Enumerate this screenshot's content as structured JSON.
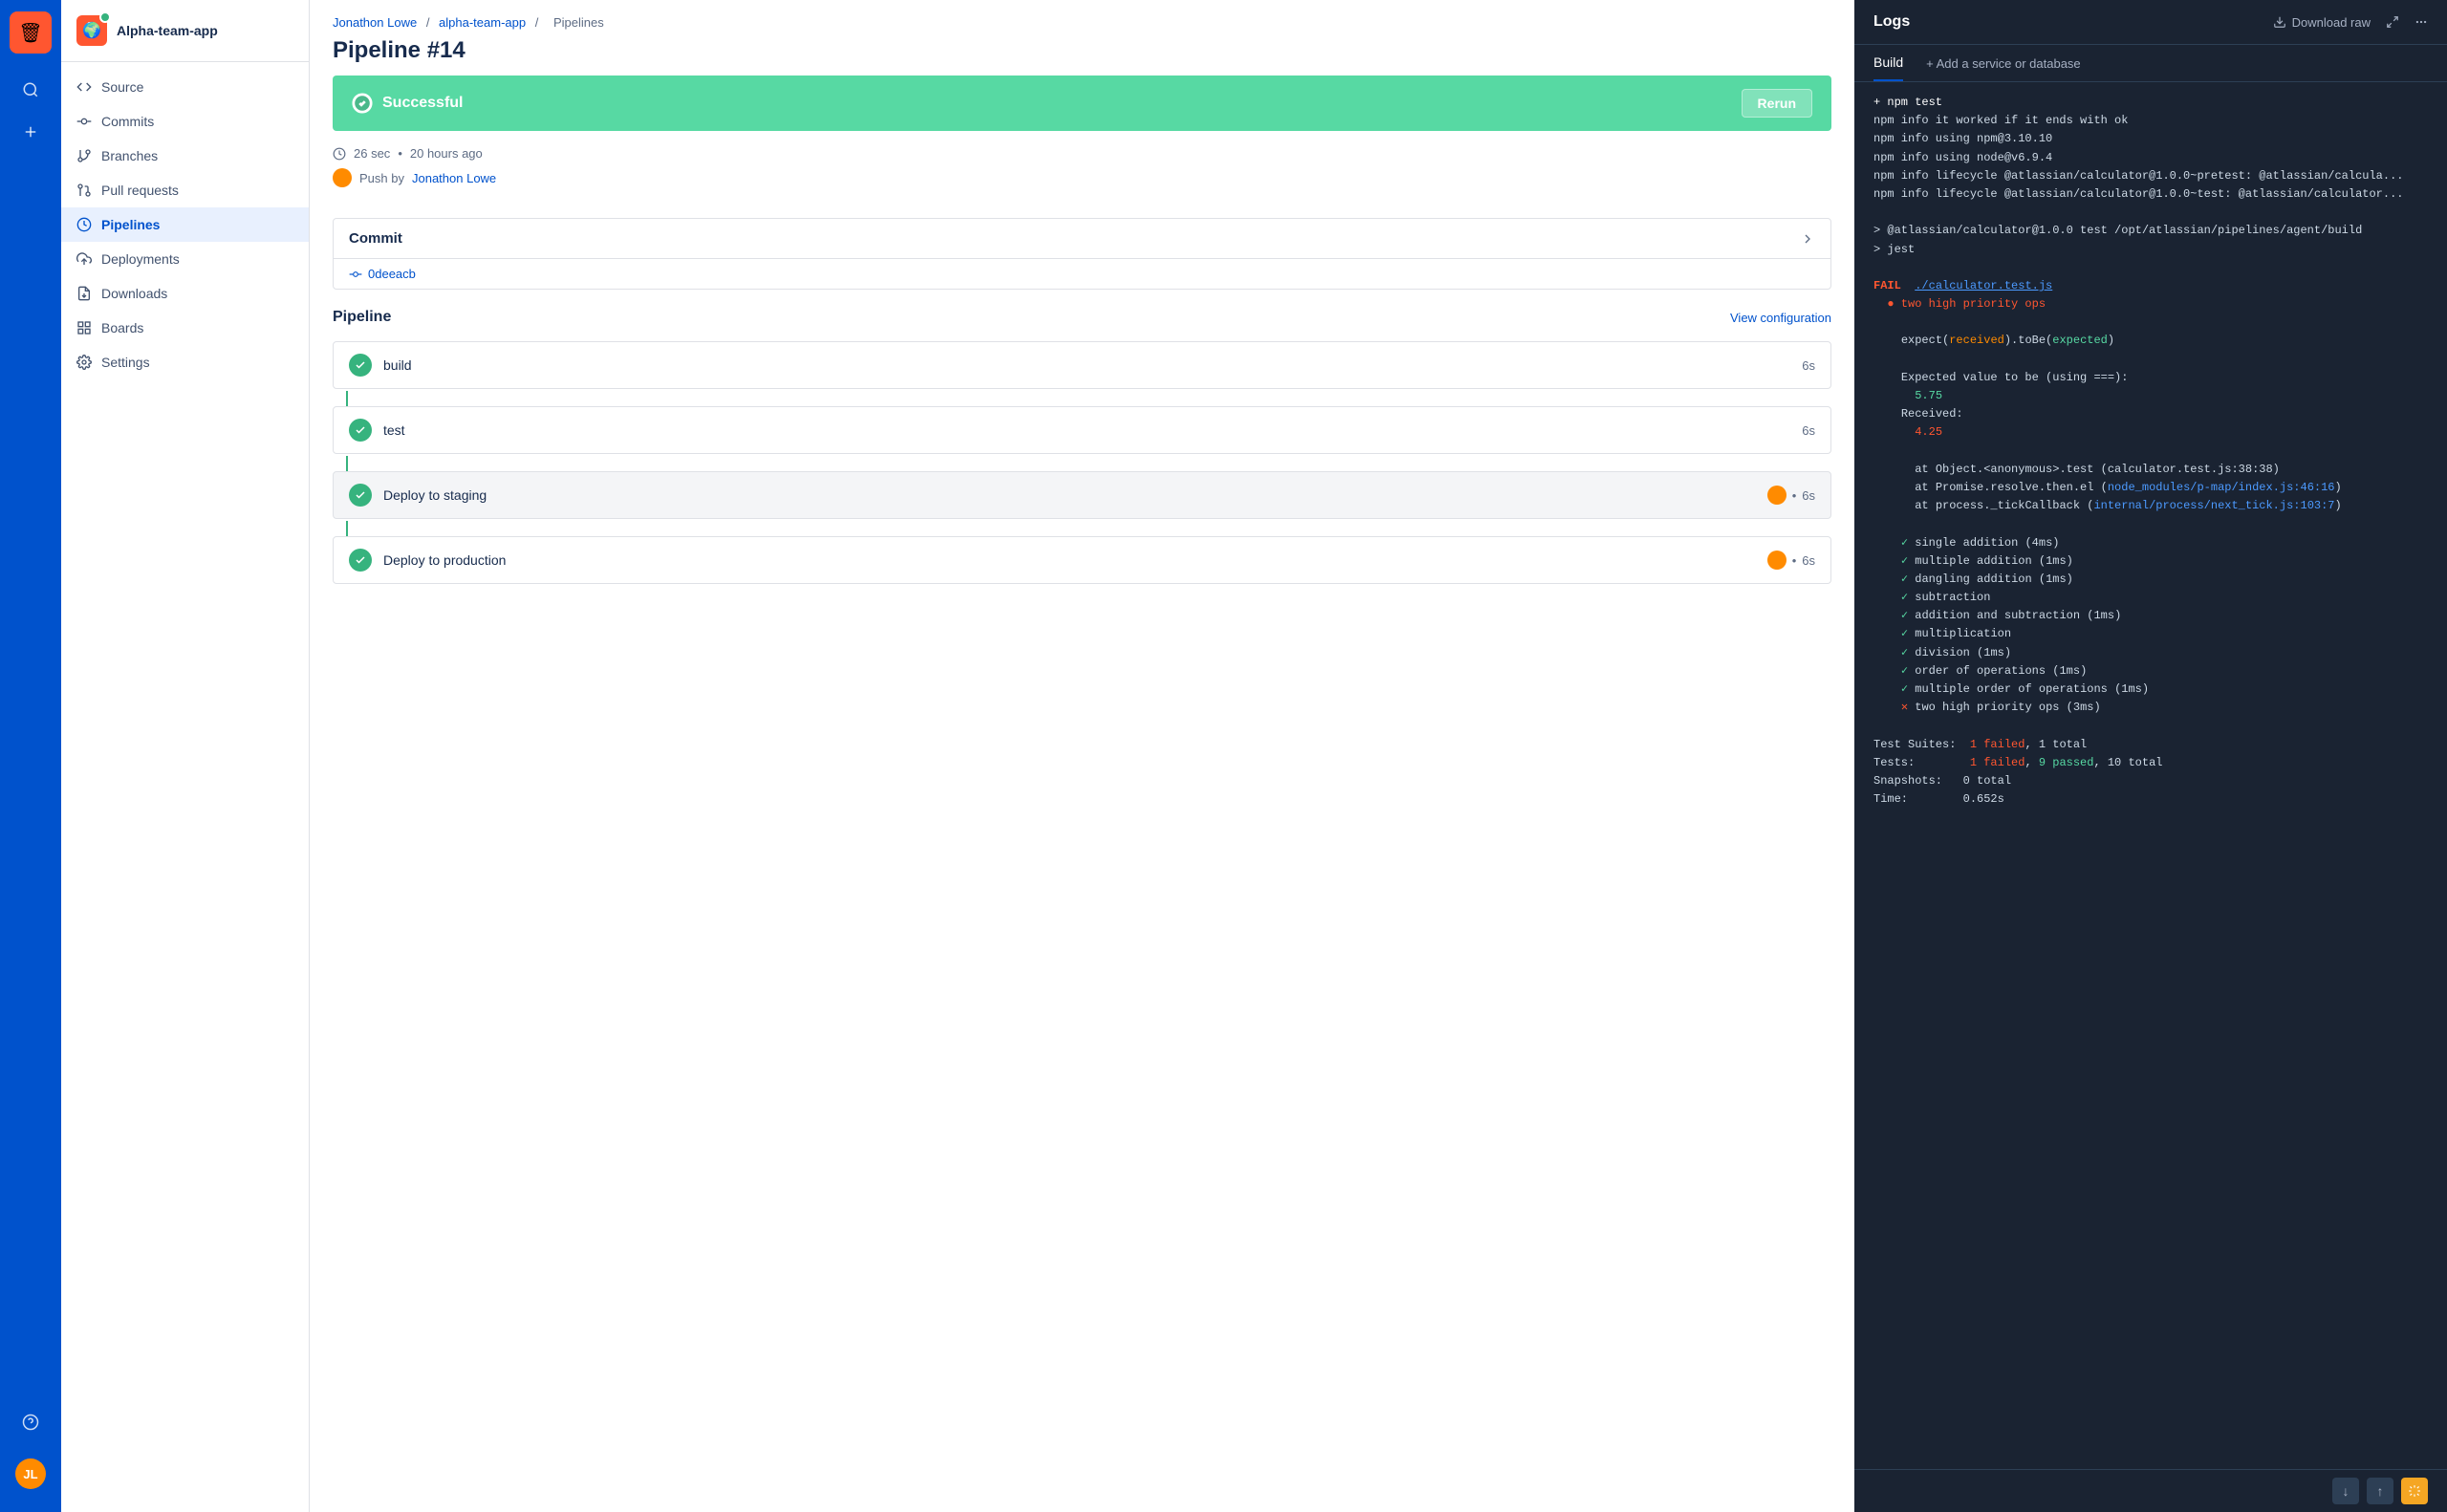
{
  "iconBar": {
    "appEmoji": "🗑",
    "searchLabel": "search",
    "addLabel": "add",
    "helpLabel": "help",
    "userLabel": "user"
  },
  "sidebar": {
    "appName": "Alpha-team-app",
    "appEmoji": "🌍",
    "navItems": [
      {
        "id": "source",
        "label": "Source",
        "icon": "code"
      },
      {
        "id": "commits",
        "label": "Commits",
        "icon": "commits"
      },
      {
        "id": "branches",
        "label": "Branches",
        "icon": "branches"
      },
      {
        "id": "pull-requests",
        "label": "Pull requests",
        "icon": "pr"
      },
      {
        "id": "pipelines",
        "label": "Pipelines",
        "icon": "pipelines",
        "active": true
      },
      {
        "id": "deployments",
        "label": "Deployments",
        "icon": "deployments"
      },
      {
        "id": "downloads",
        "label": "Downloads",
        "icon": "downloads"
      },
      {
        "id": "boards",
        "label": "Boards",
        "icon": "boards"
      },
      {
        "id": "settings",
        "label": "Settings",
        "icon": "settings"
      }
    ]
  },
  "breadcrumb": {
    "items": [
      "Jonathon Lowe",
      "alpha-team-app",
      "Pipelines"
    ]
  },
  "pipeline": {
    "title": "Pipeline #14",
    "status": "Successful",
    "statusColor": "#57d9a3",
    "rerunLabel": "Rerun",
    "duration": "26 sec",
    "timeAgo": "20 hours ago",
    "pushText": "Push by",
    "author": "Jonathon Lowe",
    "commitSection": {
      "label": "Commit",
      "hash": "0deeacb"
    },
    "pipelineSection": {
      "title": "Pipeline",
      "viewConfigLabel": "View configuration",
      "steps": [
        {
          "name": "build",
          "duration": "6s",
          "active": false
        },
        {
          "name": "test",
          "duration": "6s",
          "active": false
        },
        {
          "name": "Deploy to staging",
          "duration": "6s",
          "hasAvatar": true,
          "active": true
        },
        {
          "name": "Deploy to production",
          "duration": "6s",
          "hasAvatar": true,
          "active": false
        }
      ]
    }
  },
  "logs": {
    "title": "Logs",
    "downloadRawLabel": "Download raw",
    "expandLabel": "expand",
    "moreLabel": "more",
    "tabs": [
      {
        "id": "build",
        "label": "Build",
        "active": true
      }
    ],
    "addServiceLabel": "+ Add a service or database",
    "content": [
      {
        "type": "white",
        "text": "+ npm test"
      },
      {
        "type": "normal",
        "text": "npm info it worked if it ends with ok"
      },
      {
        "type": "normal",
        "text": "npm info using npm@3.10.10"
      },
      {
        "type": "normal",
        "text": "npm info using node@v6.9.4"
      },
      {
        "type": "normal",
        "text": "npm info lifecycle @atlassian/calculator@1.0.0~pretest: @atlassian/calcula..."
      },
      {
        "type": "normal",
        "text": "npm info lifecycle @atlassian/calculator@1.0.0~test: @atlassian/calculator..."
      },
      {
        "type": "blank",
        "text": ""
      },
      {
        "type": "normal",
        "text": "> @atlassian/calculator@1.0.0 test /opt/atlassian/pipelines/agent/build"
      },
      {
        "type": "normal",
        "text": "> jest"
      },
      {
        "type": "blank",
        "text": ""
      },
      {
        "type": "fail",
        "text": "FAIL  ./calculator.test.js"
      },
      {
        "type": "red-bullet",
        "text": "  ● two high priority ops"
      },
      {
        "type": "blank",
        "text": ""
      },
      {
        "type": "expect",
        "text": "    expect(received).toBe(expected)"
      },
      {
        "type": "blank",
        "text": ""
      },
      {
        "type": "normal",
        "text": "    Expected value to be (using ===):"
      },
      {
        "type": "green-val",
        "text": "      5.75"
      },
      {
        "type": "normal",
        "text": "    Received:"
      },
      {
        "type": "red-val",
        "text": "      4.25"
      },
      {
        "type": "blank",
        "text": ""
      },
      {
        "type": "normal",
        "text": "      at Object.<anonymous>.test (calculator.test.js:38:38)"
      },
      {
        "type": "normal-link",
        "text": "      at Promise.resolve.then.el (node_modules/p-map/index.js:46:16)"
      },
      {
        "type": "normal-link2",
        "text": "      at process._tickCallback (internal/process/next_tick.js:103:7)"
      },
      {
        "type": "blank",
        "text": ""
      },
      {
        "type": "pass",
        "text": "    ✓ single addition (4ms)"
      },
      {
        "type": "pass",
        "text": "    ✓ multiple addition (1ms)"
      },
      {
        "type": "pass",
        "text": "    ✓ dangling addition (1ms)"
      },
      {
        "type": "pass",
        "text": "    ✓ subtraction"
      },
      {
        "type": "pass",
        "text": "    ✓ addition and subtraction (1ms)"
      },
      {
        "type": "pass",
        "text": "    ✓ multiplication"
      },
      {
        "type": "pass",
        "text": "    ✓ division (1ms)"
      },
      {
        "type": "pass",
        "text": "    ✓ order of operations (1ms)"
      },
      {
        "type": "pass",
        "text": "    ✓ multiple order of operations (1ms)"
      },
      {
        "type": "fail-x",
        "text": "    ✕ two high priority ops (3ms)"
      },
      {
        "type": "blank",
        "text": ""
      },
      {
        "type": "suites",
        "text": "Test Suites:  1 failed, 1 total"
      },
      {
        "type": "tests",
        "text": "Tests:        1 failed, 9 passed, 10 total"
      },
      {
        "type": "normal",
        "text": "Snapshots:   0 total"
      },
      {
        "type": "normal",
        "text": "Time:        0.652s"
      }
    ]
  }
}
